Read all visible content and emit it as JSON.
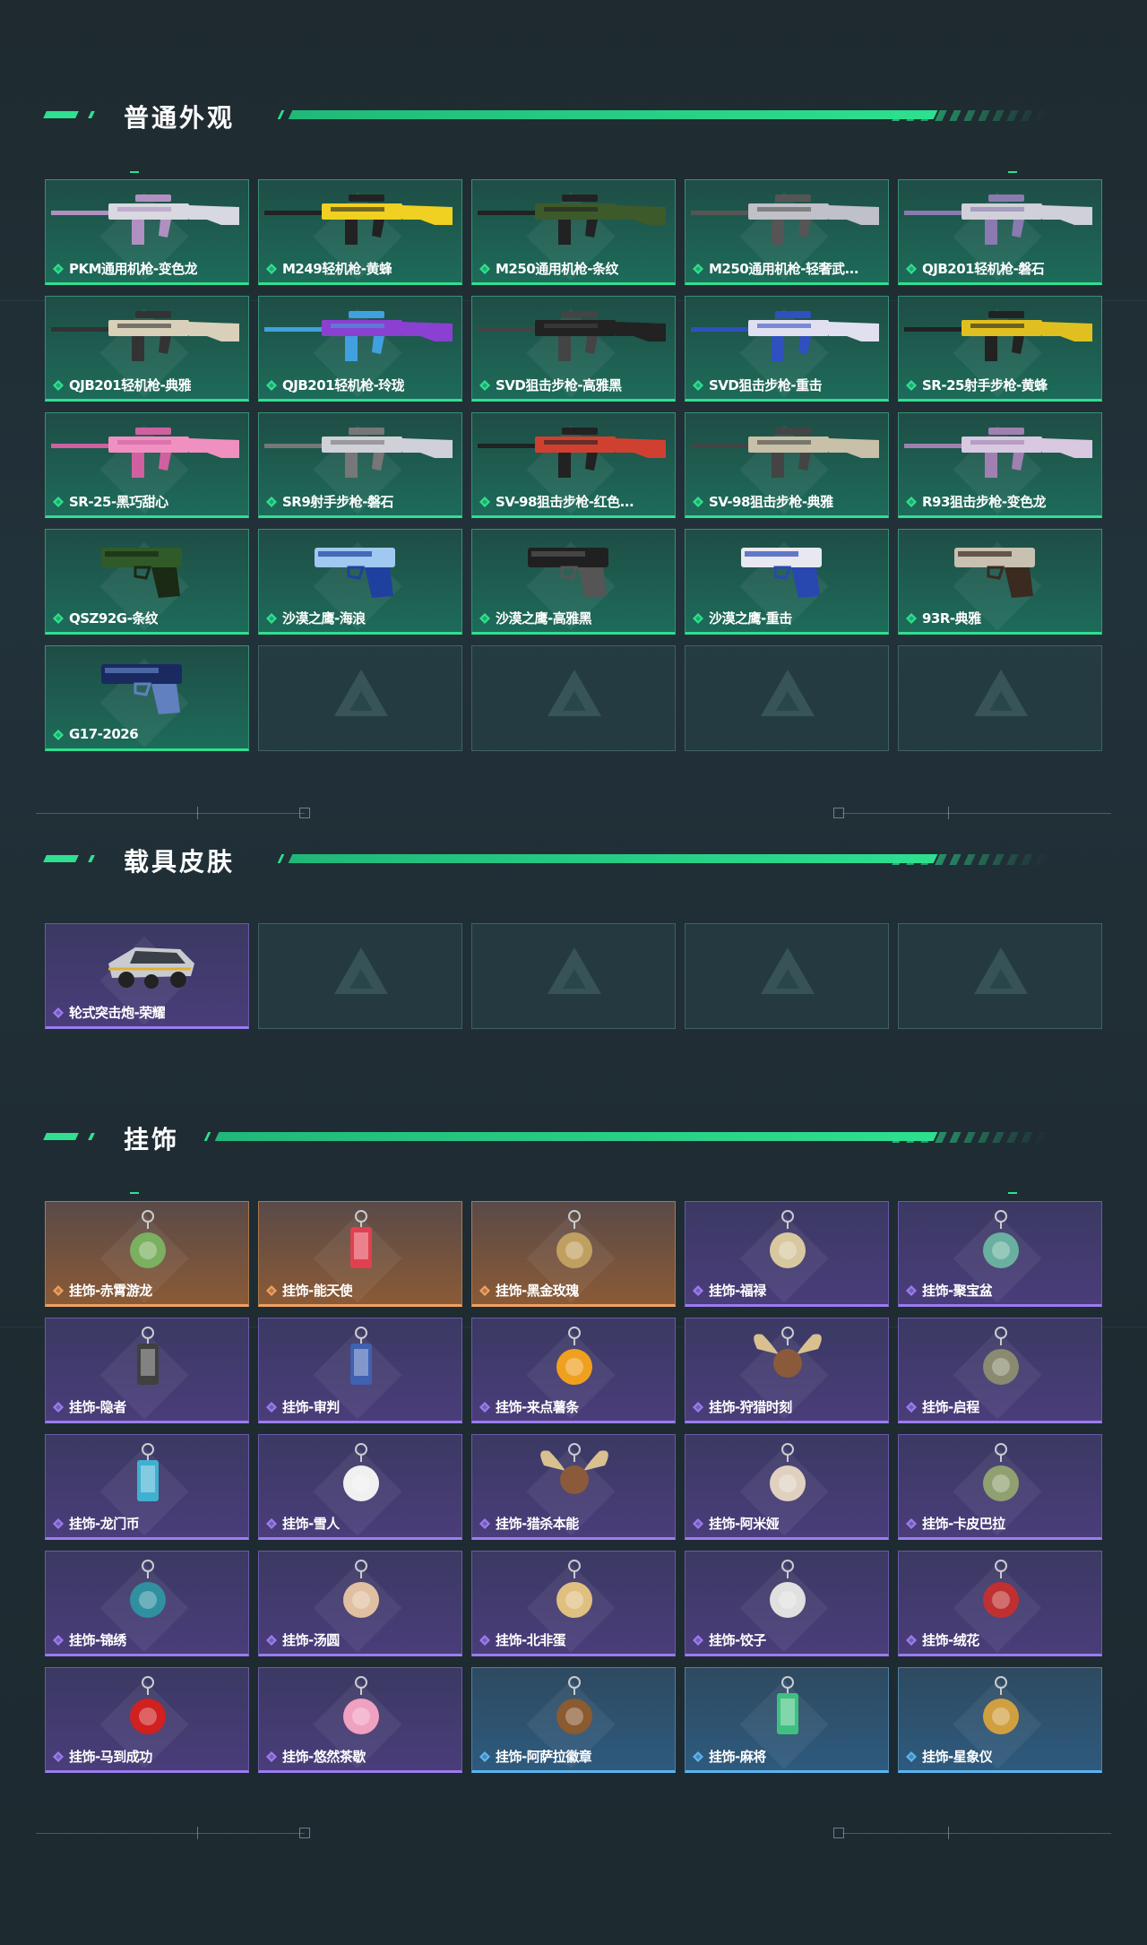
{
  "sections": {
    "weapon_skins": {
      "title": "普通外观"
    },
    "vehicle_skins": {
      "title": "载具皮肤"
    },
    "charms": {
      "title": "挂饰"
    }
  },
  "weapons": [
    {
      "name": "PKM通用机枪-变色龙",
      "rarity": "green"
    },
    {
      "name": "M249轻机枪-黄蜂",
      "rarity": "green"
    },
    {
      "name": "M250通用机枪-条纹",
      "rarity": "green"
    },
    {
      "name": "M250通用机枪-轻奢武...",
      "rarity": "green"
    },
    {
      "name": "QJB201轻机枪-磐石",
      "rarity": "green"
    },
    {
      "name": "QJB201轻机枪-典雅",
      "rarity": "green"
    },
    {
      "name": "QJB201轻机枪-玲珑",
      "rarity": "green"
    },
    {
      "name": "SVD狙击步枪-高雅黑",
      "rarity": "green"
    },
    {
      "name": "SVD狙击步枪-重击",
      "rarity": "green"
    },
    {
      "name": "SR-25射手步枪-黄蜂",
      "rarity": "green"
    },
    {
      "name": "SR-25-黑巧甜心",
      "rarity": "green"
    },
    {
      "name": "SR9射手步枪-磐石",
      "rarity": "green"
    },
    {
      "name": "SV-98狙击步枪-红色...",
      "rarity": "green"
    },
    {
      "name": "SV-98狙击步枪-典雅",
      "rarity": "green"
    },
    {
      "name": "R93狙击步枪-变色龙",
      "rarity": "green"
    },
    {
      "name": "QSZ92G-条纹",
      "rarity": "green"
    },
    {
      "name": "沙漠之鹰-海浪",
      "rarity": "green"
    },
    {
      "name": "沙漠之鹰-高雅黑",
      "rarity": "green"
    },
    {
      "name": "沙漠之鹰-重击",
      "rarity": "green"
    },
    {
      "name": "93R-典雅",
      "rarity": "green"
    },
    {
      "name": "G17-2026",
      "rarity": "green"
    }
  ],
  "weapon_empty_slots": 4,
  "vehicles": [
    {
      "name": "轮式突击炮-荣耀",
      "rarity": "purple"
    }
  ],
  "vehicle_empty_slots": 4,
  "charms": [
    {
      "name": "挂饰-赤霄游龙",
      "rarity": "orange"
    },
    {
      "name": "挂饰-能天使",
      "rarity": "orange"
    },
    {
      "name": "挂饰-黑金玫瑰",
      "rarity": "orange"
    },
    {
      "name": "挂饰-福禄",
      "rarity": "purple"
    },
    {
      "name": "挂饰-聚宝盆",
      "rarity": "purple"
    },
    {
      "name": "挂饰-隐者",
      "rarity": "purple"
    },
    {
      "name": "挂饰-审判",
      "rarity": "purple"
    },
    {
      "name": "挂饰-来点薯条",
      "rarity": "purple"
    },
    {
      "name": "挂饰-狩猎时刻",
      "rarity": "purple"
    },
    {
      "name": "挂饰-启程",
      "rarity": "purple"
    },
    {
      "name": "挂饰-龙门币",
      "rarity": "purple"
    },
    {
      "name": "挂饰-雪人",
      "rarity": "purple"
    },
    {
      "name": "挂饰-猎杀本能",
      "rarity": "purple"
    },
    {
      "name": "挂饰-阿米娅",
      "rarity": "purple"
    },
    {
      "name": "挂饰-卡皮巴拉",
      "rarity": "purple"
    },
    {
      "name": "挂饰-锦绣",
      "rarity": "purple"
    },
    {
      "name": "挂饰-汤圆",
      "rarity": "purple"
    },
    {
      "name": "挂饰-北非蛋",
      "rarity": "purple"
    },
    {
      "name": "挂饰-饺子",
      "rarity": "purple"
    },
    {
      "name": "挂饰-绒花",
      "rarity": "purple"
    },
    {
      "name": "挂饰-马到成功",
      "rarity": "purple"
    },
    {
      "name": "挂饰-悠然茶歇",
      "rarity": "purple"
    },
    {
      "name": "挂饰-阿萨拉徽章",
      "rarity": "blue"
    },
    {
      "name": "挂饰-麻将",
      "rarity": "blue"
    },
    {
      "name": "挂饰-星象仪",
      "rarity": "blue"
    }
  ],
  "colors": {
    "accent": "#2ee08f",
    "green": "#2ee08f",
    "purple": "#9b7cf0",
    "orange": "#f0a060",
    "blue": "#5cb4f0"
  }
}
